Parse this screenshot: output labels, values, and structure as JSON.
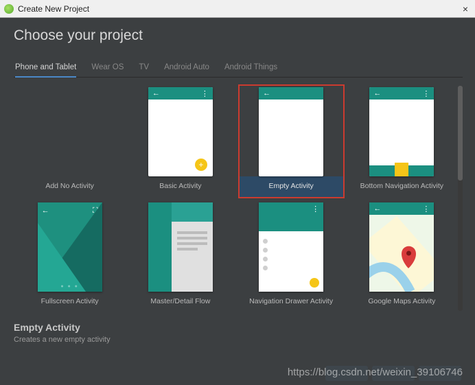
{
  "titlebar": {
    "text": "Create New Project",
    "close": "×"
  },
  "heading": "Choose your project",
  "tabs": [
    {
      "label": "Phone and Tablet",
      "active": true
    },
    {
      "label": "Wear OS",
      "active": false
    },
    {
      "label": "TV",
      "active": false
    },
    {
      "label": "Android Auto",
      "active": false
    },
    {
      "label": "Android Things",
      "active": false
    }
  ],
  "templates": [
    {
      "label": "Add No Activity",
      "kind": "none",
      "selected": false
    },
    {
      "label": "Basic Activity",
      "kind": "basic",
      "selected": false
    },
    {
      "label": "Empty Activity",
      "kind": "empty",
      "selected": true
    },
    {
      "label": "Bottom Navigation Activity",
      "kind": "bottomnav",
      "selected": false
    },
    {
      "label": "Fullscreen Activity",
      "kind": "fullscreen",
      "selected": false
    },
    {
      "label": "Master/Detail Flow",
      "kind": "master",
      "selected": false
    },
    {
      "label": "Navigation Drawer Activity",
      "kind": "navdrawer",
      "selected": false
    },
    {
      "label": "Google Maps Activity",
      "kind": "maps",
      "selected": false
    }
  ],
  "footer": {
    "title": "Empty Activity",
    "desc": "Creates a new empty activity"
  },
  "watermark": "https://blog.csdn.net/weixin_39106746"
}
